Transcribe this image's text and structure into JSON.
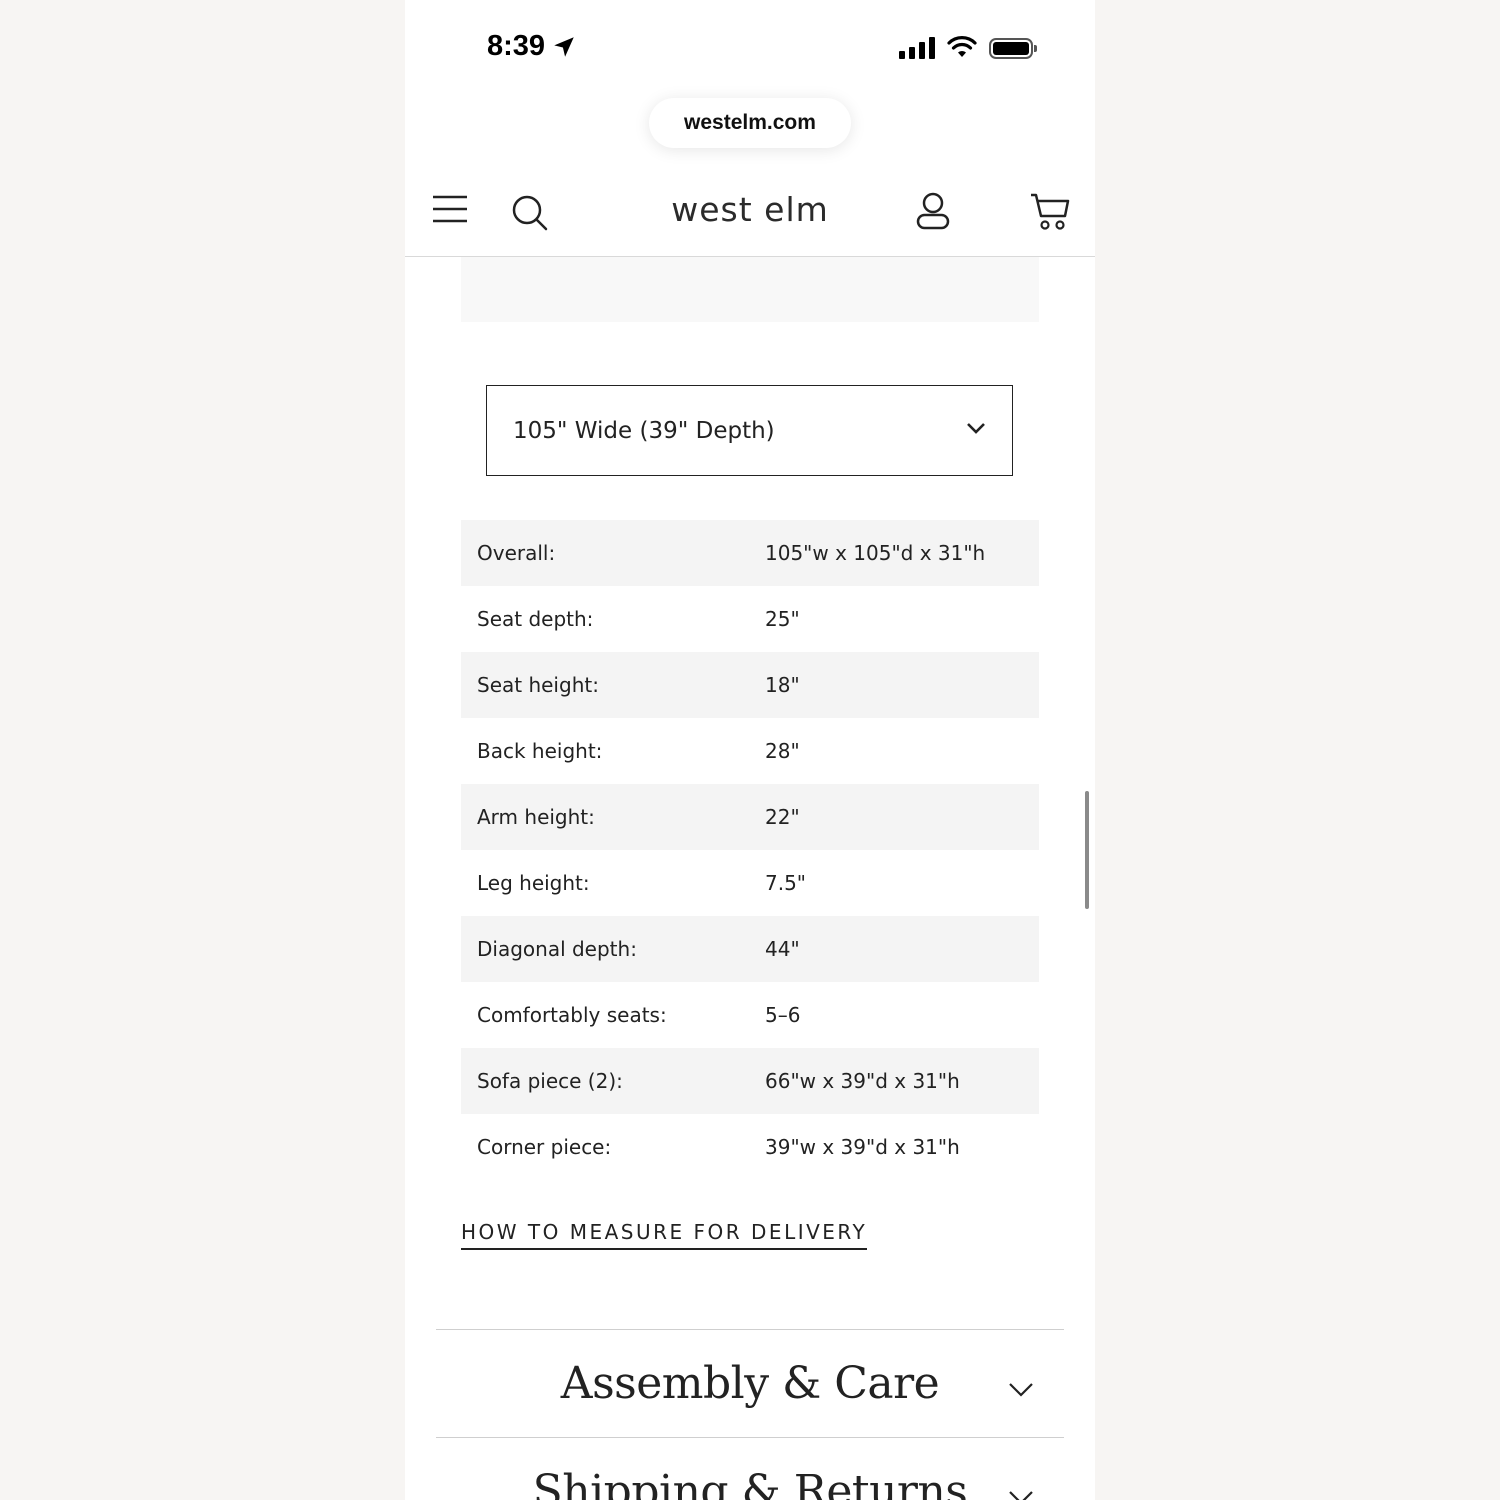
{
  "status_bar": {
    "time": "8:39"
  },
  "browser": {
    "url": "westelm.com"
  },
  "header": {
    "logo": "west elm",
    "icons": [
      "menu-icon",
      "search-icon",
      "account-icon",
      "cart-icon"
    ]
  },
  "size_selector": {
    "selected": "105\" Wide (39\" Depth)"
  },
  "dimensions": [
    {
      "label": "Overall:",
      "value": "105\"w x 105\"d x 31\"h"
    },
    {
      "label": "Seat depth:",
      "value": "25\""
    },
    {
      "label": "Seat height:",
      "value": "18\""
    },
    {
      "label": "Back height:",
      "value": "28\""
    },
    {
      "label": "Arm height:",
      "value": "22\""
    },
    {
      "label": "Leg height:",
      "value": "7.5\""
    },
    {
      "label": "Diagonal depth:",
      "value": "44\""
    },
    {
      "label": "Comfortably seats:",
      "value": "5–6"
    },
    {
      "label": "Sofa piece (2):",
      "value": "66\"w x 39\"d x 31\"h"
    },
    {
      "label": "Corner piece:",
      "value": "39\"w x 39\"d x 31\"h"
    }
  ],
  "measure_link": "HOW TO MEASURE FOR DELIVERY",
  "accordions": [
    {
      "title": "Assembly & Care"
    },
    {
      "title": "Shipping & Returns"
    }
  ]
}
